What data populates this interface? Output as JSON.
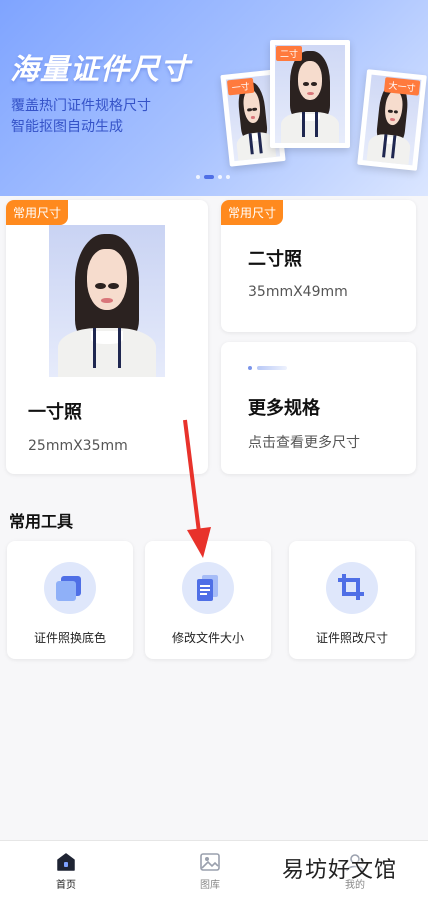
{
  "banner": {
    "title": "海量证件尺寸",
    "subtitle_line1": "覆盖热门证件规格尺寸",
    "subtitle_line2": "智能抠图自动生成",
    "photo_tags": [
      "一寸",
      "二寸",
      "大一寸"
    ]
  },
  "cards": {
    "one_inch": {
      "tag": "常用尺寸",
      "title": "一寸照",
      "size": "25mmX35mm"
    },
    "two_inch": {
      "tag": "常用尺寸",
      "title": "二寸照",
      "size": "35mmX49mm"
    },
    "more": {
      "title": "更多规格",
      "subtitle": "点击查看更多尺寸"
    }
  },
  "tools": {
    "section_title": "常用工具",
    "items": [
      {
        "label": "证件照换底色",
        "icon": "layers-icon"
      },
      {
        "label": "修改文件大小",
        "icon": "document-icon"
      },
      {
        "label": "证件照改尺寸",
        "icon": "crop-icon"
      }
    ]
  },
  "tabbar": {
    "items": [
      {
        "label": "首页",
        "icon": "home-icon",
        "active": true
      },
      {
        "label": "图库",
        "icon": "gallery-icon",
        "active": false
      },
      {
        "label": "我的",
        "icon": "profile-icon",
        "active": false
      }
    ]
  },
  "watermark": "易坊好文馆",
  "colors": {
    "accent": "#4f6fe6",
    "tag_orange": "#ff8a1e",
    "annotation_red": "#e8322b"
  }
}
